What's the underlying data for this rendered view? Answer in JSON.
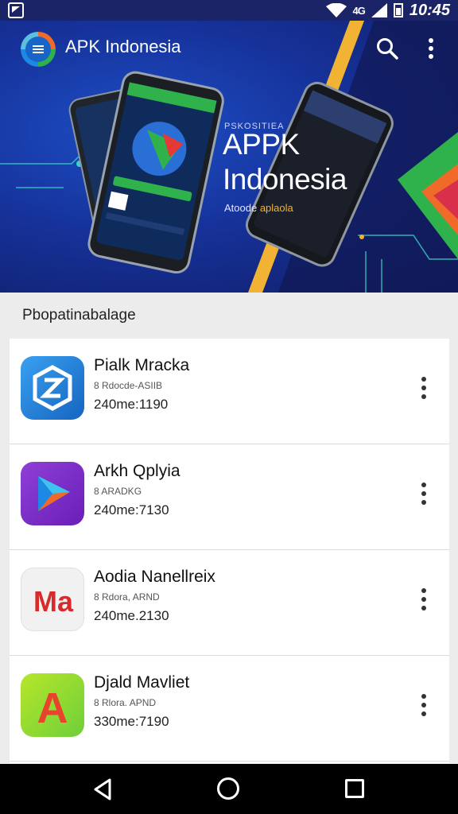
{
  "status_bar": {
    "network_label": "4G",
    "time": "10:45",
    "icons": [
      "notification-icon",
      "wifi-icon",
      "signal-icon",
      "battery-icon"
    ]
  },
  "app_bar": {
    "title": "APK Indonesia",
    "icons": [
      "menu-icon",
      "search-icon",
      "more-vert-icon"
    ]
  },
  "banner": {
    "small_caption": "PSKOSITIEA",
    "title_line1": "APPK",
    "title_line2": "Indonesia",
    "tag_prefix": "Atoode",
    "tag_accent": "aplaola"
  },
  "section": {
    "title": "Pbopatinabalage"
  },
  "apps": [
    {
      "name": "Pialk Mracka",
      "meta": "8 Rdocde-ASIIB",
      "size": "240me:1190",
      "icon": "shield-app-icon"
    },
    {
      "name": "Arkh Qplyia",
      "meta": "8 ARADKG",
      "size": "240me:7130",
      "icon": "play-app-icon"
    },
    {
      "name": "Aodia Nanellreix",
      "meta": "8 Rdora, ARND",
      "size": "240me.2130",
      "icon": "ma-app-icon",
      "icon_text": "Ma"
    },
    {
      "name": "Djald Mavliet",
      "meta": "8 Rlora. APND",
      "size": "330me:7190",
      "icon": "a-app-icon",
      "icon_text": "A"
    }
  ],
  "colors": {
    "banner_dark": "#0f1c63",
    "banner_blue": "#16329a",
    "accent_yellow": "#f2b233",
    "accent_green": "#2fb14b",
    "navbar": "#000000"
  },
  "nav": {
    "icons": [
      "back-icon",
      "home-icon",
      "recents-icon"
    ]
  }
}
